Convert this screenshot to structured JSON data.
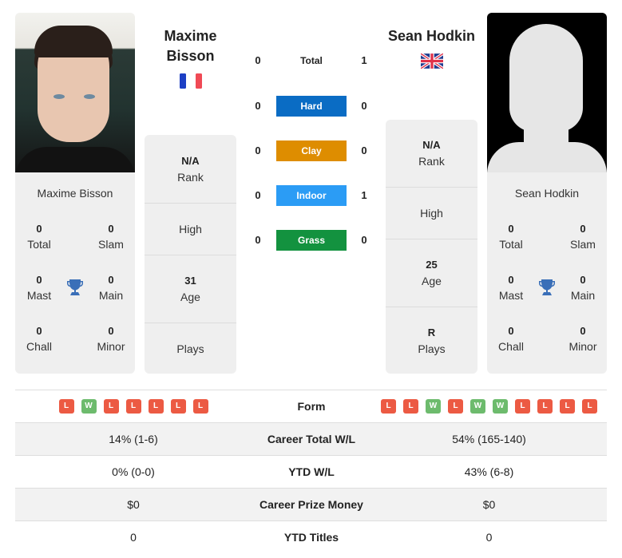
{
  "player1": {
    "name_line1": "Maxime",
    "name_line2": "Bisson",
    "full_name": "Maxime Bisson",
    "flag": "france-flag",
    "photo": "player-photo",
    "titles": {
      "total": {
        "value": "0",
        "label": "Total"
      },
      "slam": {
        "value": "0",
        "label": "Slam"
      },
      "mast": {
        "value": "0",
        "label": "Mast"
      },
      "main": {
        "value": "0",
        "label": "Main"
      },
      "chall": {
        "value": "0",
        "label": "Chall"
      },
      "minor": {
        "value": "0",
        "label": "Minor"
      }
    },
    "info": {
      "rank": {
        "value": "N/A",
        "label": "Rank"
      },
      "high": {
        "value": "",
        "label": "High"
      },
      "age": {
        "value": "31",
        "label": "Age"
      },
      "plays": {
        "value": "",
        "label": "Plays"
      }
    }
  },
  "player2": {
    "name": "Sean Hodkin",
    "full_name": "Sean Hodkin",
    "flag": "uk-flag",
    "photo": "silhouette-placeholder",
    "titles": {
      "total": {
        "value": "0",
        "label": "Total"
      },
      "slam": {
        "value": "0",
        "label": "Slam"
      },
      "mast": {
        "value": "0",
        "label": "Mast"
      },
      "main": {
        "value": "0",
        "label": "Main"
      },
      "chall": {
        "value": "0",
        "label": "Chall"
      },
      "minor": {
        "value": "0",
        "label": "Minor"
      }
    },
    "info": {
      "rank": {
        "value": "N/A",
        "label": "Rank"
      },
      "high": {
        "value": "",
        "label": "High"
      },
      "age": {
        "value": "25",
        "label": "Age"
      },
      "plays": {
        "value": "R",
        "label": "Plays"
      }
    }
  },
  "surfaces": [
    {
      "label": "Total",
      "p1": "0",
      "p2": "1",
      "color": null
    },
    {
      "label": "Hard",
      "p1": "0",
      "p2": "0",
      "color": "#0a6cc4"
    },
    {
      "label": "Clay",
      "p1": "0",
      "p2": "0",
      "color": "#de8d00"
    },
    {
      "label": "Indoor",
      "p1": "0",
      "p2": "1",
      "color": "#2b9cf5"
    },
    {
      "label": "Grass",
      "p1": "0",
      "p2": "0",
      "color": "#13923f"
    }
  ],
  "form": {
    "label": "Form",
    "p1": [
      "L",
      "W",
      "L",
      "L",
      "L",
      "L",
      "L"
    ],
    "p2": [
      "L",
      "L",
      "W",
      "L",
      "W",
      "W",
      "L",
      "L",
      "L",
      "L"
    ]
  },
  "stats": [
    {
      "label": "Career Total W/L",
      "p1": "14% (1-6)",
      "p2": "54% (165-140)"
    },
    {
      "label": "YTD W/L",
      "p1": "0% (0-0)",
      "p2": "43% (6-8)"
    },
    {
      "label": "Career Prize Money",
      "p1": "$0",
      "p2": "$0"
    },
    {
      "label": "YTD Titles",
      "p1": "0",
      "p2": "0"
    }
  ],
  "colors": {
    "loss": "#ec5a43",
    "win": "#6dbb6d",
    "trophy": "#3a6fb8",
    "card_bg": "#efefef"
  }
}
